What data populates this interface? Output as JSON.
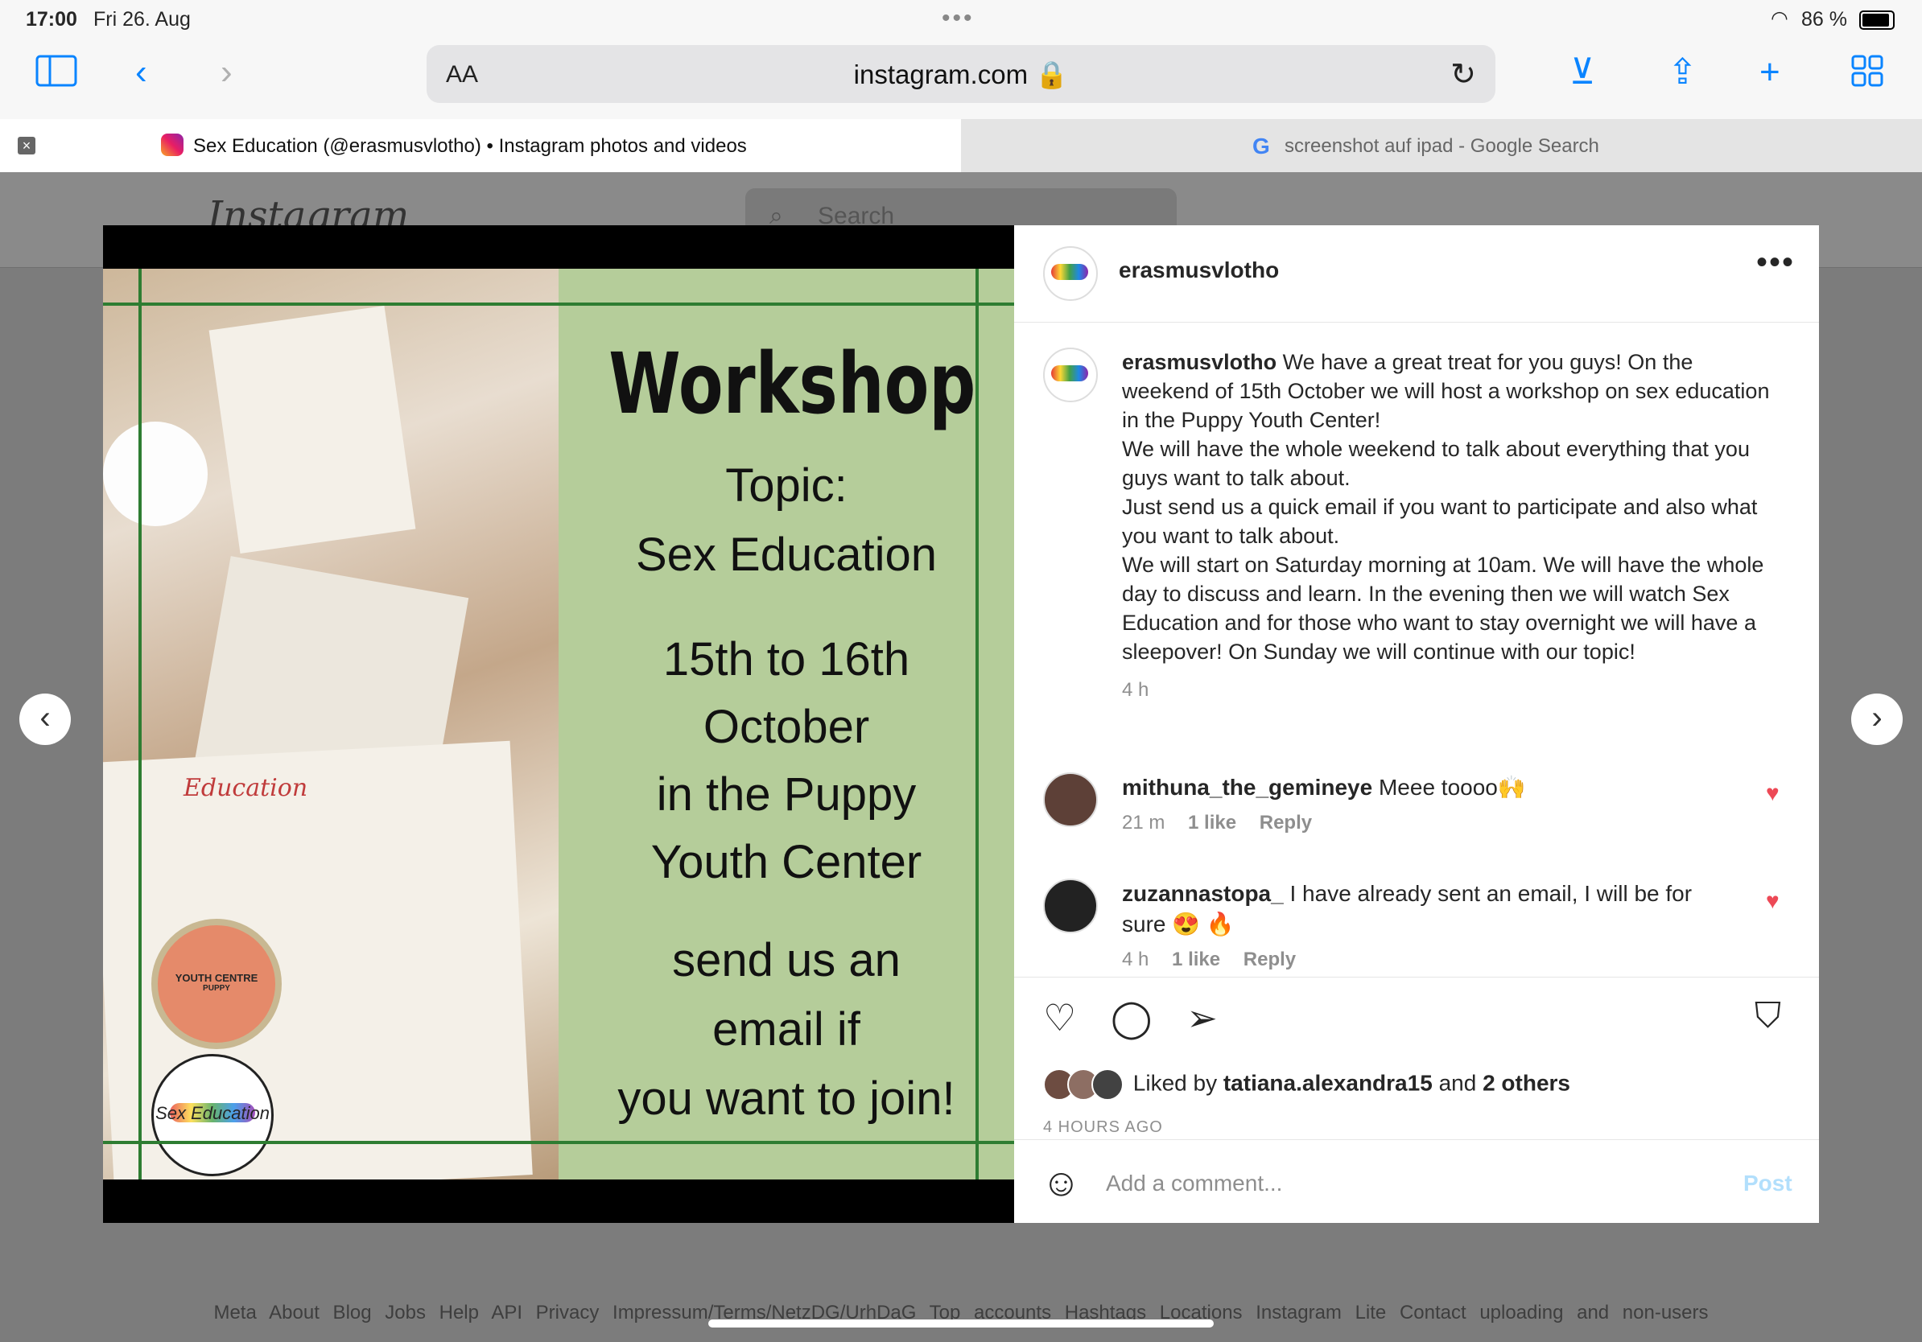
{
  "status": {
    "time": "17:00",
    "date": "Fri 26. Aug",
    "battery": "86 %"
  },
  "browser": {
    "aa": "AA",
    "url": "instagram.com",
    "tabs": [
      {
        "title": "Sex Education (@erasmusvlotho) • Instagram photos and videos"
      },
      {
        "title": "screenshot auf ipad - Google Search"
      }
    ]
  },
  "background": {
    "logo": "Instagram",
    "search_placeholder": "Search",
    "footer": "Meta About Blog Jobs Help API Privacy Impressum/Terms/NetzDG/UrhDaG Top accounts Hashtags Locations Instagram Lite Contact uploading and non-users"
  },
  "poster": {
    "headline": "Workshop",
    "topic_label": "Topic:",
    "topic": "Sex Education",
    "dates_1": "15th to 16th",
    "dates_2": "October",
    "place_1": "in the Puppy",
    "place_2": "Youth Center",
    "cta_1": "send us an",
    "cta_2": "email if",
    "cta_3": "you want to join!",
    "photo_text": "Education",
    "badge_1": "YOUTH CENTRE",
    "badge_1b": "PUPPY",
    "badge_2": "Sex Education"
  },
  "post": {
    "author": "erasmusvlotho",
    "caption_author": "erasmusvlotho",
    "caption": "We have a great treat for you guys! On the weekend of 15th October we will host a workshop on sex education in the Puppy Youth Center!\nWe will have the whole weekend to talk about everything that you guys want to talk about.\nJust send us a quick email if you want to participate and also what you want to talk about.\nWe will start on Saturday morning at 10am. We will have the whole day to discuss and learn. In the evening then we will watch Sex Education and for those who want to stay overnight we will have a sleepover! On Sunday we will continue with our topic!",
    "caption_time": "4 h",
    "comments": [
      {
        "user": "mithuna_the_gemineye",
        "text": "Meee toooo🙌",
        "time": "21 m",
        "likes": "1 like",
        "reply": "Reply"
      },
      {
        "user": "zuzannastopa_",
        "text": "I have already sent an email, I will be for sure 😍 🔥",
        "time": "4 h",
        "likes": "1 like",
        "reply": "Reply"
      }
    ],
    "liked_prefix": "Liked by",
    "liked_user": "tatiana.alexandra15",
    "liked_and": "and",
    "liked_others": "2 others",
    "posted_ago": "4 HOURS AGO",
    "comment_placeholder": "Add a comment...",
    "post_button": "Post"
  },
  "colors": {
    "accent": "#0a84ff",
    "poster_green": "#b5cd9a",
    "like_red": "#ed4956"
  }
}
